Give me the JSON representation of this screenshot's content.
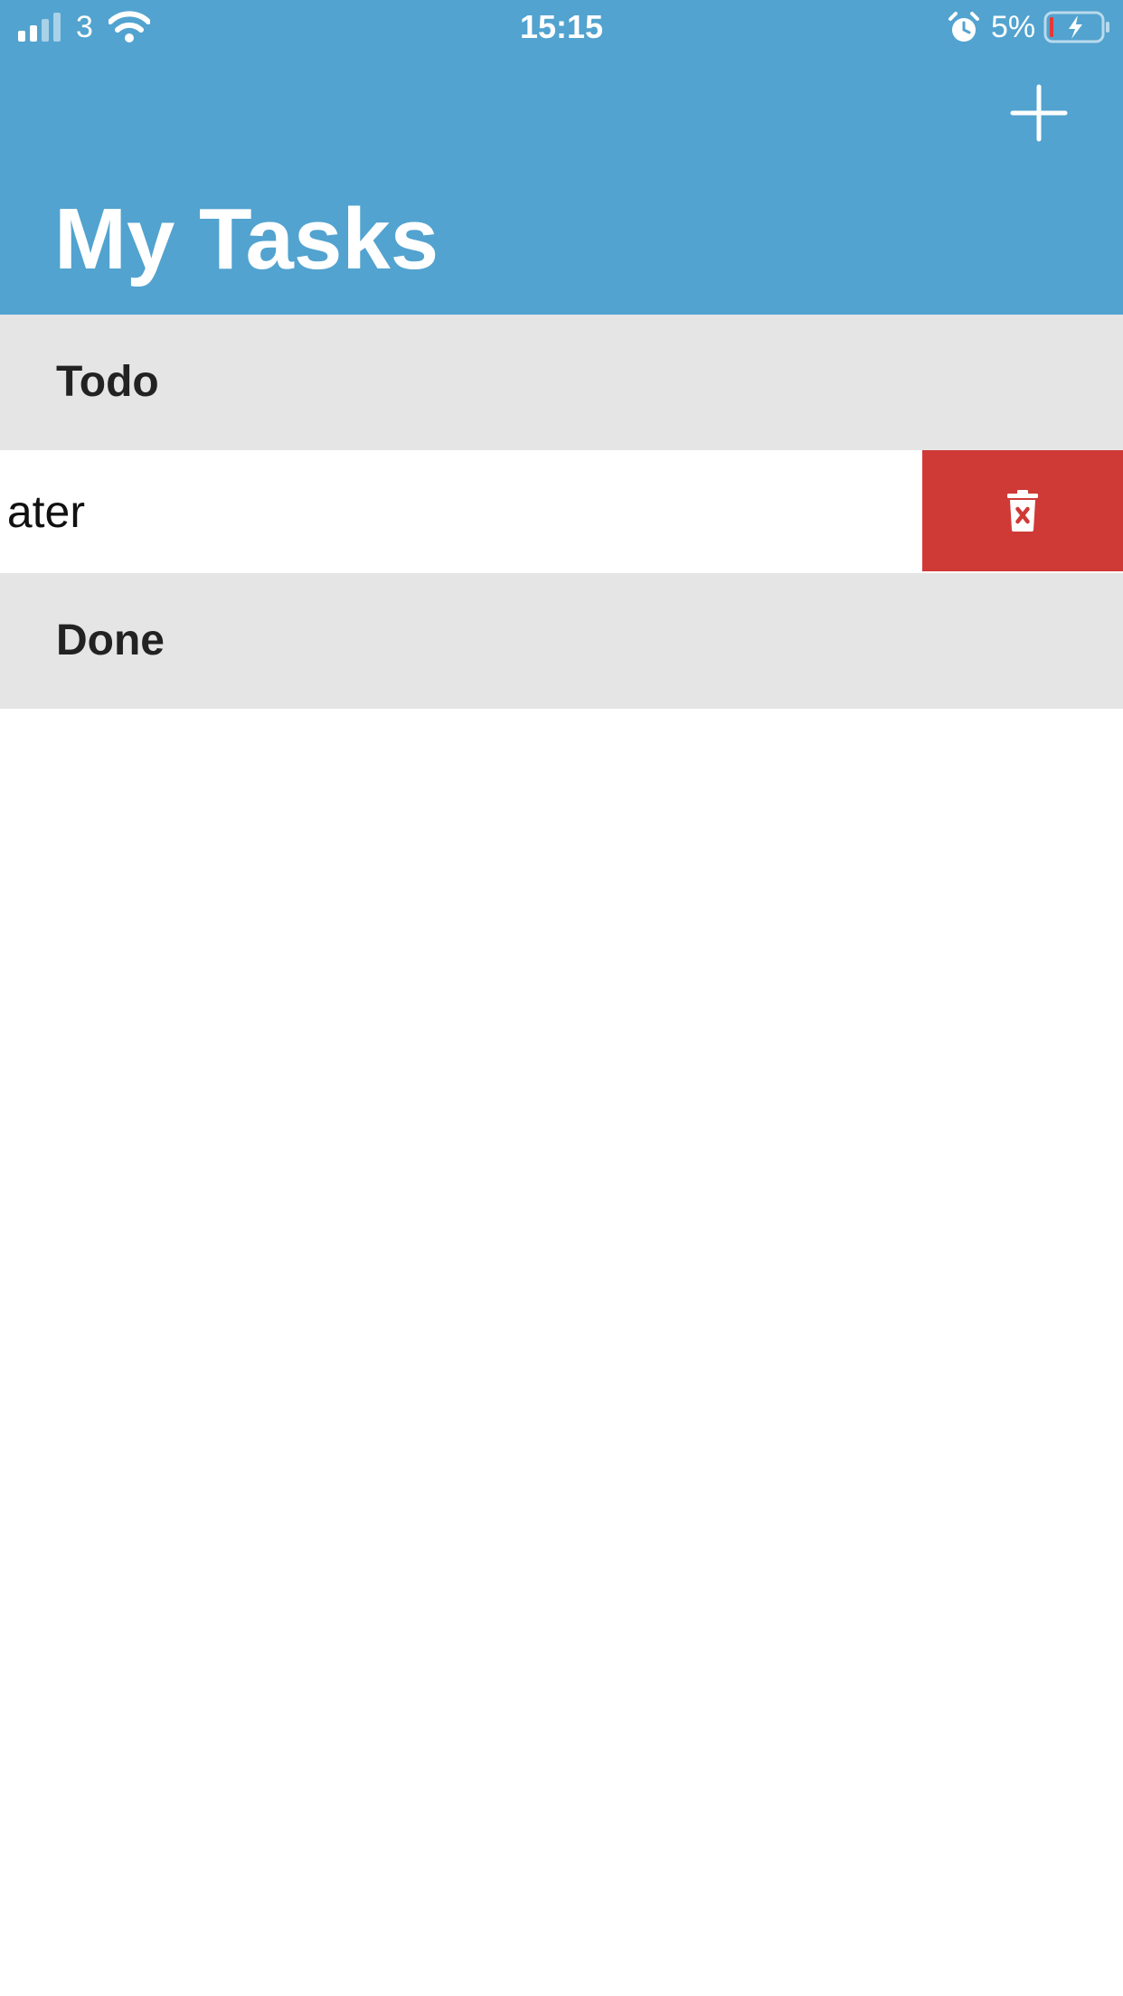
{
  "status_bar": {
    "carrier": "3",
    "time": "15:15",
    "battery_percent": "5%"
  },
  "header": {
    "title": "My Tasks",
    "add_icon": "plus-icon"
  },
  "sections": {
    "todo": {
      "label": "Todo"
    },
    "done": {
      "label": "Done"
    }
  },
  "tasks": [
    {
      "text": "Drink water",
      "visible_fragment": "ater",
      "swipe_action": "delete",
      "action_icon": "trash-x-icon"
    }
  ],
  "colors": {
    "header_bg": "#52a3cf",
    "section_bg": "#e5e5e5",
    "delete_bg": "#cf3a36",
    "text_dark": "#222222"
  }
}
